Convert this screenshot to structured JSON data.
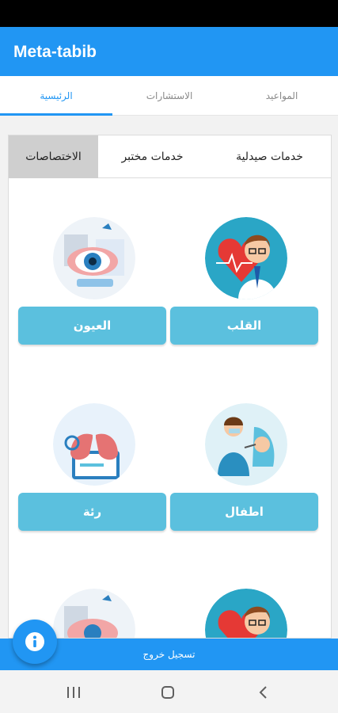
{
  "app": {
    "title": "Meta-tabib"
  },
  "tabs": [
    {
      "label": "المواعيد"
    },
    {
      "label": "الاستشارات"
    },
    {
      "label": "الرئيسية"
    }
  ],
  "segments": [
    {
      "label": "خدمات صيدلية"
    },
    {
      "label": "خدمات مختبر"
    },
    {
      "label": "الاختصاصات"
    }
  ],
  "specialties": [
    {
      "label": "القلب",
      "icon": "heart-doctor-illustration"
    },
    {
      "label": "العيون",
      "icon": "eye-exam-illustration"
    },
    {
      "label": "اطفال",
      "icon": "pediatric-dentist-illustration"
    },
    {
      "label": "رئة",
      "icon": "lungs-illustration"
    },
    {
      "label": "",
      "icon": "heart-doctor-illustration"
    },
    {
      "label": "",
      "icon": "eye-exam-illustration"
    }
  ],
  "footer": {
    "logout_label": "تسجيل خروج"
  },
  "fab": {
    "icon": "info-icon"
  },
  "system_nav": {
    "recents": "recents-icon",
    "home": "home-icon",
    "back": "back-icon"
  },
  "colors": {
    "primary": "#2196F3",
    "button": "#5bc0de",
    "active_segment": "#cfcfcf"
  }
}
